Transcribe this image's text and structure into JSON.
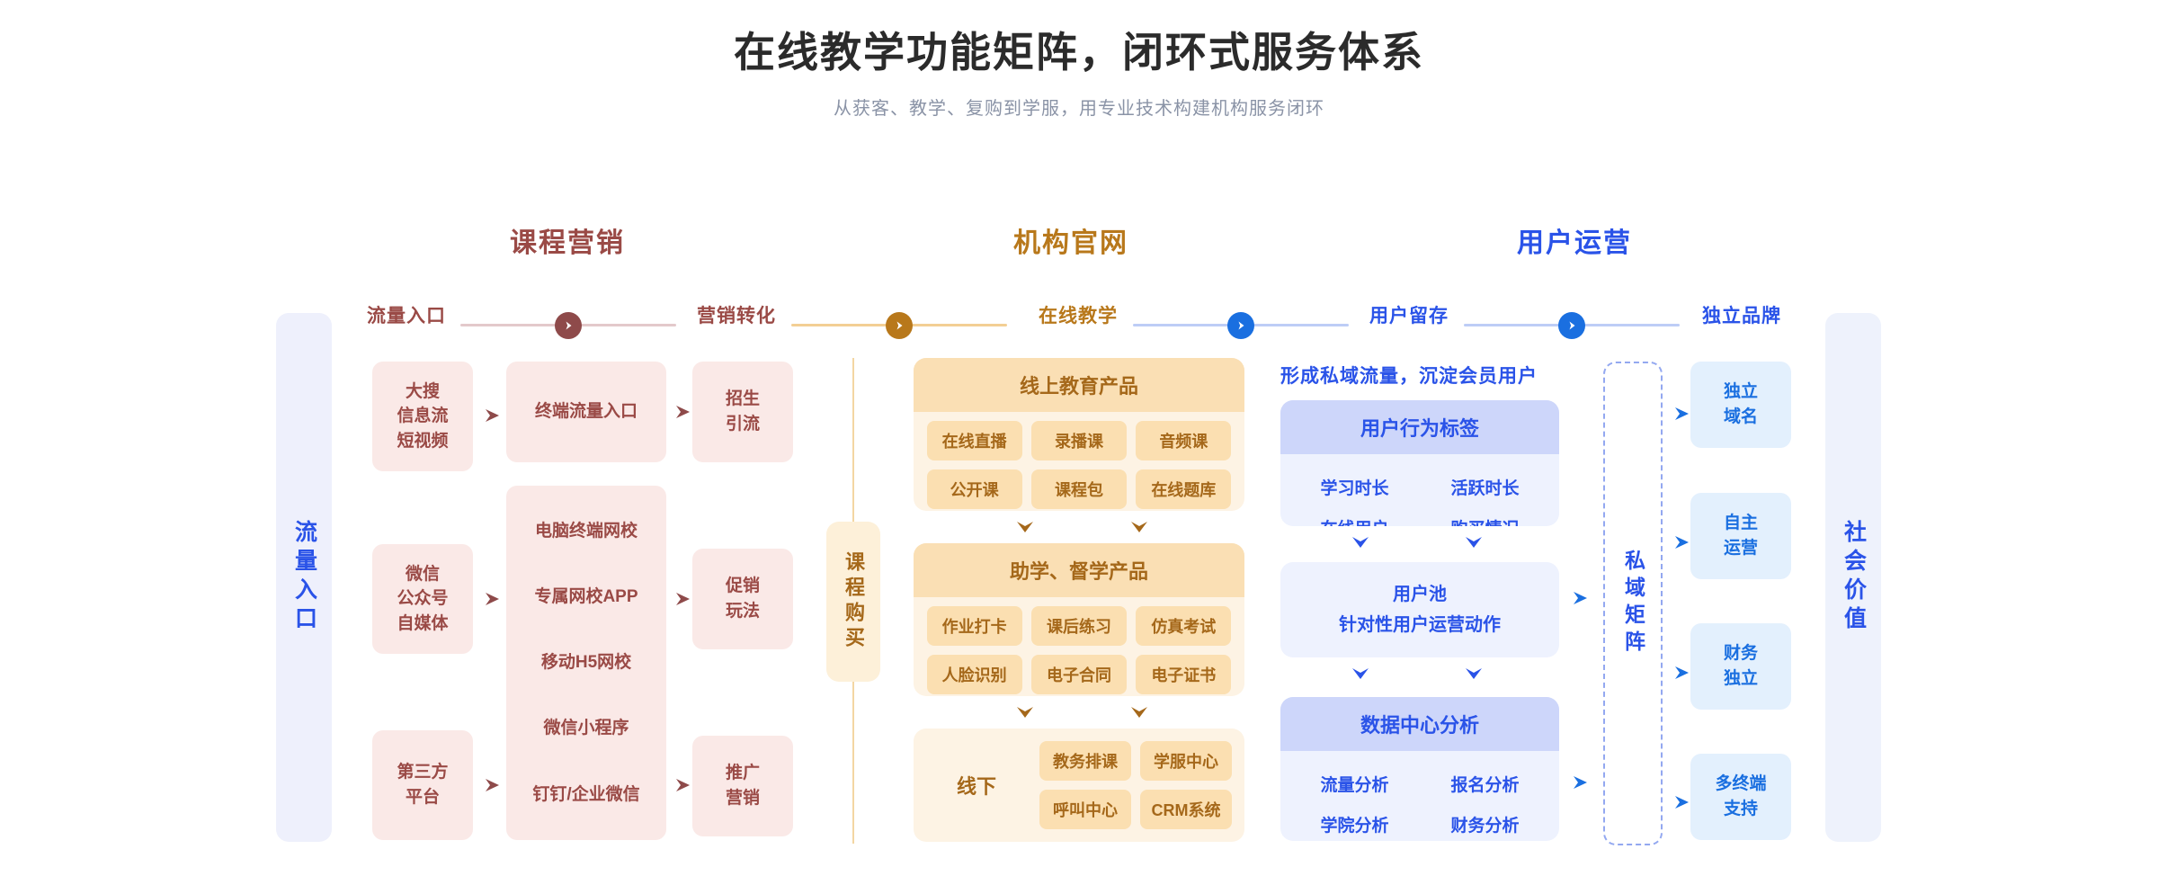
{
  "header": {
    "title": "在线教学功能矩阵，闭环式服务体系",
    "subtitle": "从获客、教学、复购到学服，用专业技术构建机构服务闭环"
  },
  "sections": [
    {
      "label": "课程营销",
      "color": "#9a4a46"
    },
    {
      "label": "机构官网",
      "color": "#b8781b"
    },
    {
      "label": "用户运营",
      "color": "#2a53e8"
    }
  ],
  "stages": [
    {
      "label": "流量入口",
      "color": "#9a4a46"
    },
    {
      "label": "营销转化",
      "color": "#9a4a46"
    },
    {
      "label": "在线教学",
      "color": "#b8781b"
    },
    {
      "label": "用户留存",
      "color": "#2a53e8"
    },
    {
      "label": "独立品牌",
      "color": "#2a53e8"
    }
  ],
  "connectors": [
    {
      "line": "#e3c9cb",
      "badge": "#8e4a4a"
    },
    {
      "line": "#f3cf94",
      "badge": "#b8781b"
    },
    {
      "line": "#bdcdf6",
      "badge": "#1a6fe0"
    },
    {
      "line": "#bdcdf6",
      "badge": "#1a6fe0"
    }
  ],
  "left_rail": {
    "label": "流量入口",
    "bg": "#eef0fc",
    "color": "#2a53e8"
  },
  "right_rail": {
    "label": "社会价值",
    "bg": "#eef2fc",
    "color": "#2a53e8"
  },
  "traffic_sources": [
    {
      "lines": [
        "大搜",
        "信息流",
        "短视频"
      ]
    },
    {
      "lines": [
        "微信",
        "公众号",
        "自媒体"
      ]
    },
    {
      "lines": [
        "第三方",
        "平台"
      ]
    }
  ],
  "terminal": {
    "top_card": "终端流量入口",
    "items": [
      "电脑终端网校",
      "专属网校APP",
      "移动H5网校",
      "微信小程序",
      "钉钉/企业微信"
    ]
  },
  "conversion_cards": [
    {
      "lines": [
        "招生",
        "引流"
      ]
    },
    {
      "lines": [
        "促销",
        "玩法"
      ]
    },
    {
      "lines": [
        "推广",
        "营销"
      ]
    }
  ],
  "purchase_rail": {
    "label": "课程购买",
    "bg": "#fdf0d9",
    "color": "#a5681a",
    "line": "#f3d6a2"
  },
  "teaching": {
    "blocks": [
      {
        "title": "线上教育产品",
        "tags": [
          "在线直播",
          "录播课",
          "音频课",
          "公开课",
          "课程包",
          "在线题库"
        ]
      },
      {
        "title": "助学、督学产品",
        "tags": [
          "作业打卡",
          "课后练习",
          "仿真考试",
          "人脸识别",
          "电子合同",
          "电子证书"
        ]
      }
    ],
    "offline": {
      "label": "线下",
      "tags": [
        "教务排课",
        "学服中心",
        "呼叫中心",
        "CRM系统"
      ]
    }
  },
  "retention": {
    "headline": "形成私域流量，沉淀会员用户",
    "tag_block": {
      "title": "用户行为标签",
      "items": [
        "学习时长",
        "活跃时长",
        "在线用户",
        "购买情况"
      ]
    },
    "pool": {
      "line1": "用户池",
      "line2": "针对性用户运营动作"
    },
    "data_block": {
      "title": "数据中心分析",
      "items": [
        "流量分析",
        "报名分析",
        "学院分析",
        "财务分析"
      ]
    }
  },
  "matrix": {
    "label": "私域矩阵",
    "border": "#93a8f0",
    "color": "#2a53e8"
  },
  "brand_cards": [
    {
      "lines": [
        "独立",
        "域名"
      ]
    },
    {
      "lines": [
        "自主",
        "运营"
      ]
    },
    {
      "lines": [
        "财务",
        "独立"
      ]
    },
    {
      "lines": [
        "多终端",
        "支持"
      ]
    }
  ]
}
